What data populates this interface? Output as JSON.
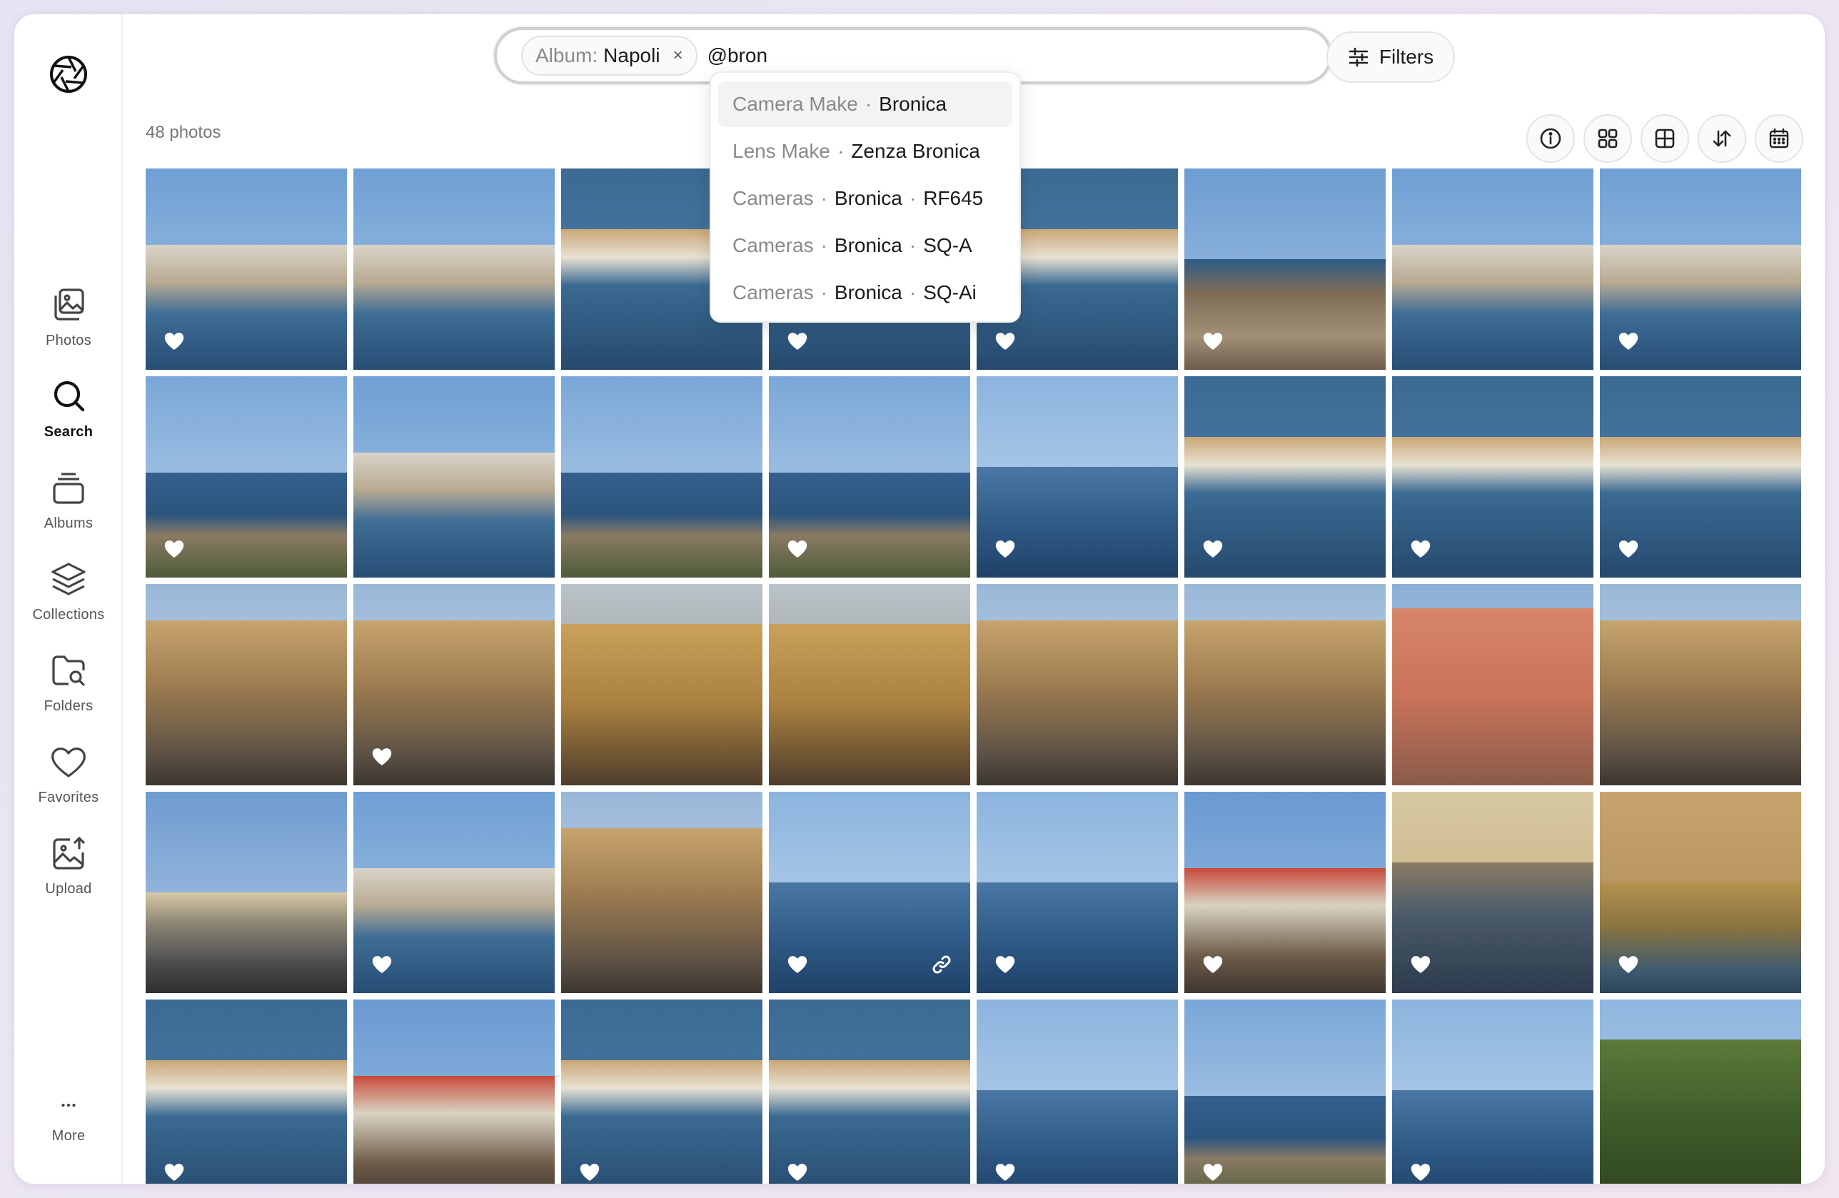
{
  "sidebar": {
    "items": [
      {
        "label": "Photos",
        "icon": "photos-icon"
      },
      {
        "label": "Search",
        "icon": "search-icon",
        "active": true
      },
      {
        "label": "Albums",
        "icon": "albums-icon"
      },
      {
        "label": "Collections",
        "icon": "collections-icon"
      },
      {
        "label": "Folders",
        "icon": "folders-icon"
      },
      {
        "label": "Favorites",
        "icon": "favorites-icon"
      },
      {
        "label": "Upload",
        "icon": "upload-icon"
      }
    ],
    "more_label": "More"
  },
  "search": {
    "chip_key": "Album:",
    "chip_value": "Napoli",
    "chip_remove": "×",
    "query": "@bron"
  },
  "filters_label": "Filters",
  "photo_count": "48 photos",
  "toolbar": [
    "info-icon",
    "grid-small-icon",
    "grid-large-icon",
    "sort-icon",
    "calendar-icon"
  ],
  "suggestions": [
    {
      "parts": [
        "Camera Make",
        "Bronica"
      ]
    },
    {
      "parts": [
        "Lens Make",
        "Zenza Bronica"
      ]
    },
    {
      "parts": [
        "Cameras",
        "Bronica",
        "RF645"
      ]
    },
    {
      "parts": [
        "Cameras",
        "Bronica",
        "SQ-A"
      ]
    },
    {
      "parts": [
        "Cameras",
        "Bronica",
        "SQ-Ai"
      ]
    }
  ],
  "suggestion_separator": "·",
  "colors": {
    "accent_bg": "#f3f3f3",
    "muted_text": "#8a8a8a",
    "sky": "#8fb5dd",
    "sea": "#2f5a86"
  },
  "photos": [
    {
      "type": "harbor",
      "fav": true
    },
    {
      "type": "harbor",
      "fav": false
    },
    {
      "type": "boats",
      "fav": false
    },
    {
      "type": "boats",
      "fav": true
    },
    {
      "type": "boats",
      "fav": true
    },
    {
      "type": "rocks",
      "fav": true
    },
    {
      "type": "harbor",
      "fav": false
    },
    {
      "type": "harbor",
      "fav": true
    },
    {
      "type": "coast",
      "fav": true
    },
    {
      "type": "harbor",
      "fav": false
    },
    {
      "type": "coast",
      "fav": false
    },
    {
      "type": "coast",
      "fav": true
    },
    {
      "type": "sea",
      "fav": true
    },
    {
      "type": "boats",
      "fav": true
    },
    {
      "type": "boats",
      "fav": true
    },
    {
      "type": "boats",
      "fav": true
    },
    {
      "type": "street",
      "fav": false
    },
    {
      "type": "street",
      "fav": true
    },
    {
      "type": "gallery",
      "fav": false
    },
    {
      "type": "gallery",
      "fav": false
    },
    {
      "type": "street",
      "fav": false
    },
    {
      "type": "street",
      "fav": false
    },
    {
      "type": "building",
      "fav": false
    },
    {
      "type": "street",
      "fav": false
    },
    {
      "type": "port",
      "fav": false
    },
    {
      "type": "harbor",
      "fav": true
    },
    {
      "type": "street",
      "fav": false
    },
    {
      "type": "sea",
      "fav": true,
      "link": true
    },
    {
      "type": "sea",
      "fav": true
    },
    {
      "type": "kiosk",
      "fav": true
    },
    {
      "type": "sunset",
      "fav": true
    },
    {
      "type": "castle",
      "fav": true
    },
    {
      "type": "boats",
      "fav": true
    },
    {
      "type": "kiosk",
      "fav": false
    },
    {
      "type": "boats",
      "fav": true
    },
    {
      "type": "boats",
      "fav": true
    },
    {
      "type": "sea",
      "fav": true
    },
    {
      "type": "coast",
      "fav": true
    },
    {
      "type": "sea",
      "fav": true
    },
    {
      "type": "trees",
      "fav": false
    }
  ]
}
